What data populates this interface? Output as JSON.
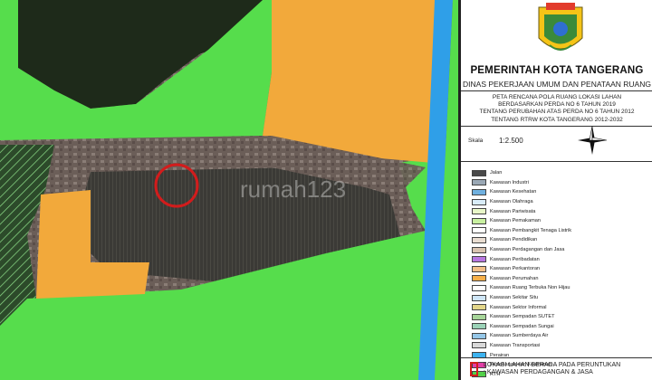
{
  "header": {
    "crest_text": "KOTA TANGERANG",
    "title": "PEMERINTAH KOTA TANGERANG",
    "subtitle": "DINAS PEKERJAAN UMUM DAN PENATAAN RUANG"
  },
  "map_title": {
    "line1": "PETA RENCANA POLA RUANG LOKASI LAHAN",
    "line2": "BERDASARKAN PERDA NO 6 TAHUN 2019",
    "line3": "TENTANG PERUBAHAN ATAS PERDA NO 6 TAHUN 2012",
    "line4": "TENTANG RTRW KOTA TANGERANG 2012-2032"
  },
  "scale": {
    "label": "Skala",
    "value": "1:2.500"
  },
  "watermark": "rumah123",
  "legend": [
    {
      "label": "Jalan",
      "color": "#4a4a4a"
    },
    {
      "label": "Kawasan Industri",
      "color": "#9aa8b5"
    },
    {
      "label": "Kawasan Kesehatan",
      "color": "#6fb0df"
    },
    {
      "label": "Kawasan Olahraga",
      "color": "#d9ecf8"
    },
    {
      "label": "Kawasan Pariwisata",
      "color": "#e8f7c8"
    },
    {
      "label": "Kawasan Pemakaman",
      "color": "#c8f0a0"
    },
    {
      "label": "Kawasan Pembangkit Tenaga Listrik",
      "color": "#ffffff"
    },
    {
      "label": "Kawasan Pendidikan",
      "color": "#e9ddd1"
    },
    {
      "label": "Kawasan Perdagangan dan Jasa",
      "color": "#d9c4b0"
    },
    {
      "label": "Kawasan Peribadatan",
      "color": "#b777e0"
    },
    {
      "label": "Kawasan Perkantoran",
      "color": "#f2c089"
    },
    {
      "label": "Kawasan Perumahan",
      "color": "#f7b04a"
    },
    {
      "label": "Kawasan Ruang Terbuka Non Hijau",
      "color": "#ffffff"
    },
    {
      "label": "Kawasan Sekitar Situ",
      "color": "#cfe6f7"
    },
    {
      "label": "Kawasan Sektor Informal",
      "color": "#e3d68a"
    },
    {
      "label": "Kawasan Sempadan SUTET",
      "color": "#a7d69a"
    },
    {
      "label": "Kawasan Sempadan Sungai",
      "color": "#9bd3b8"
    },
    {
      "label": "Kawasan Sumberdaya Air",
      "color": "#95c7e8"
    },
    {
      "label": "Kawasan Transportasi",
      "color": "#d9d9d9"
    },
    {
      "label": "Perairan",
      "color": "#3db3f0"
    },
    {
      "label": "Pertahanan dan Keamanan",
      "color": "#e23ea7"
    },
    {
      "label": "RTH",
      "color": "#53d24a"
    }
  ],
  "location_note": {
    "line1": "LOKASI LAHAN BERADA PADA PERUNTUKAN",
    "line2": ": KAWASAN PERDAGANGAN & JASA"
  },
  "colors": {
    "rth": "#56dd4c",
    "perumahan": "#f2a93b",
    "river": "#2f9fe8",
    "marker": "#d21c1c"
  }
}
